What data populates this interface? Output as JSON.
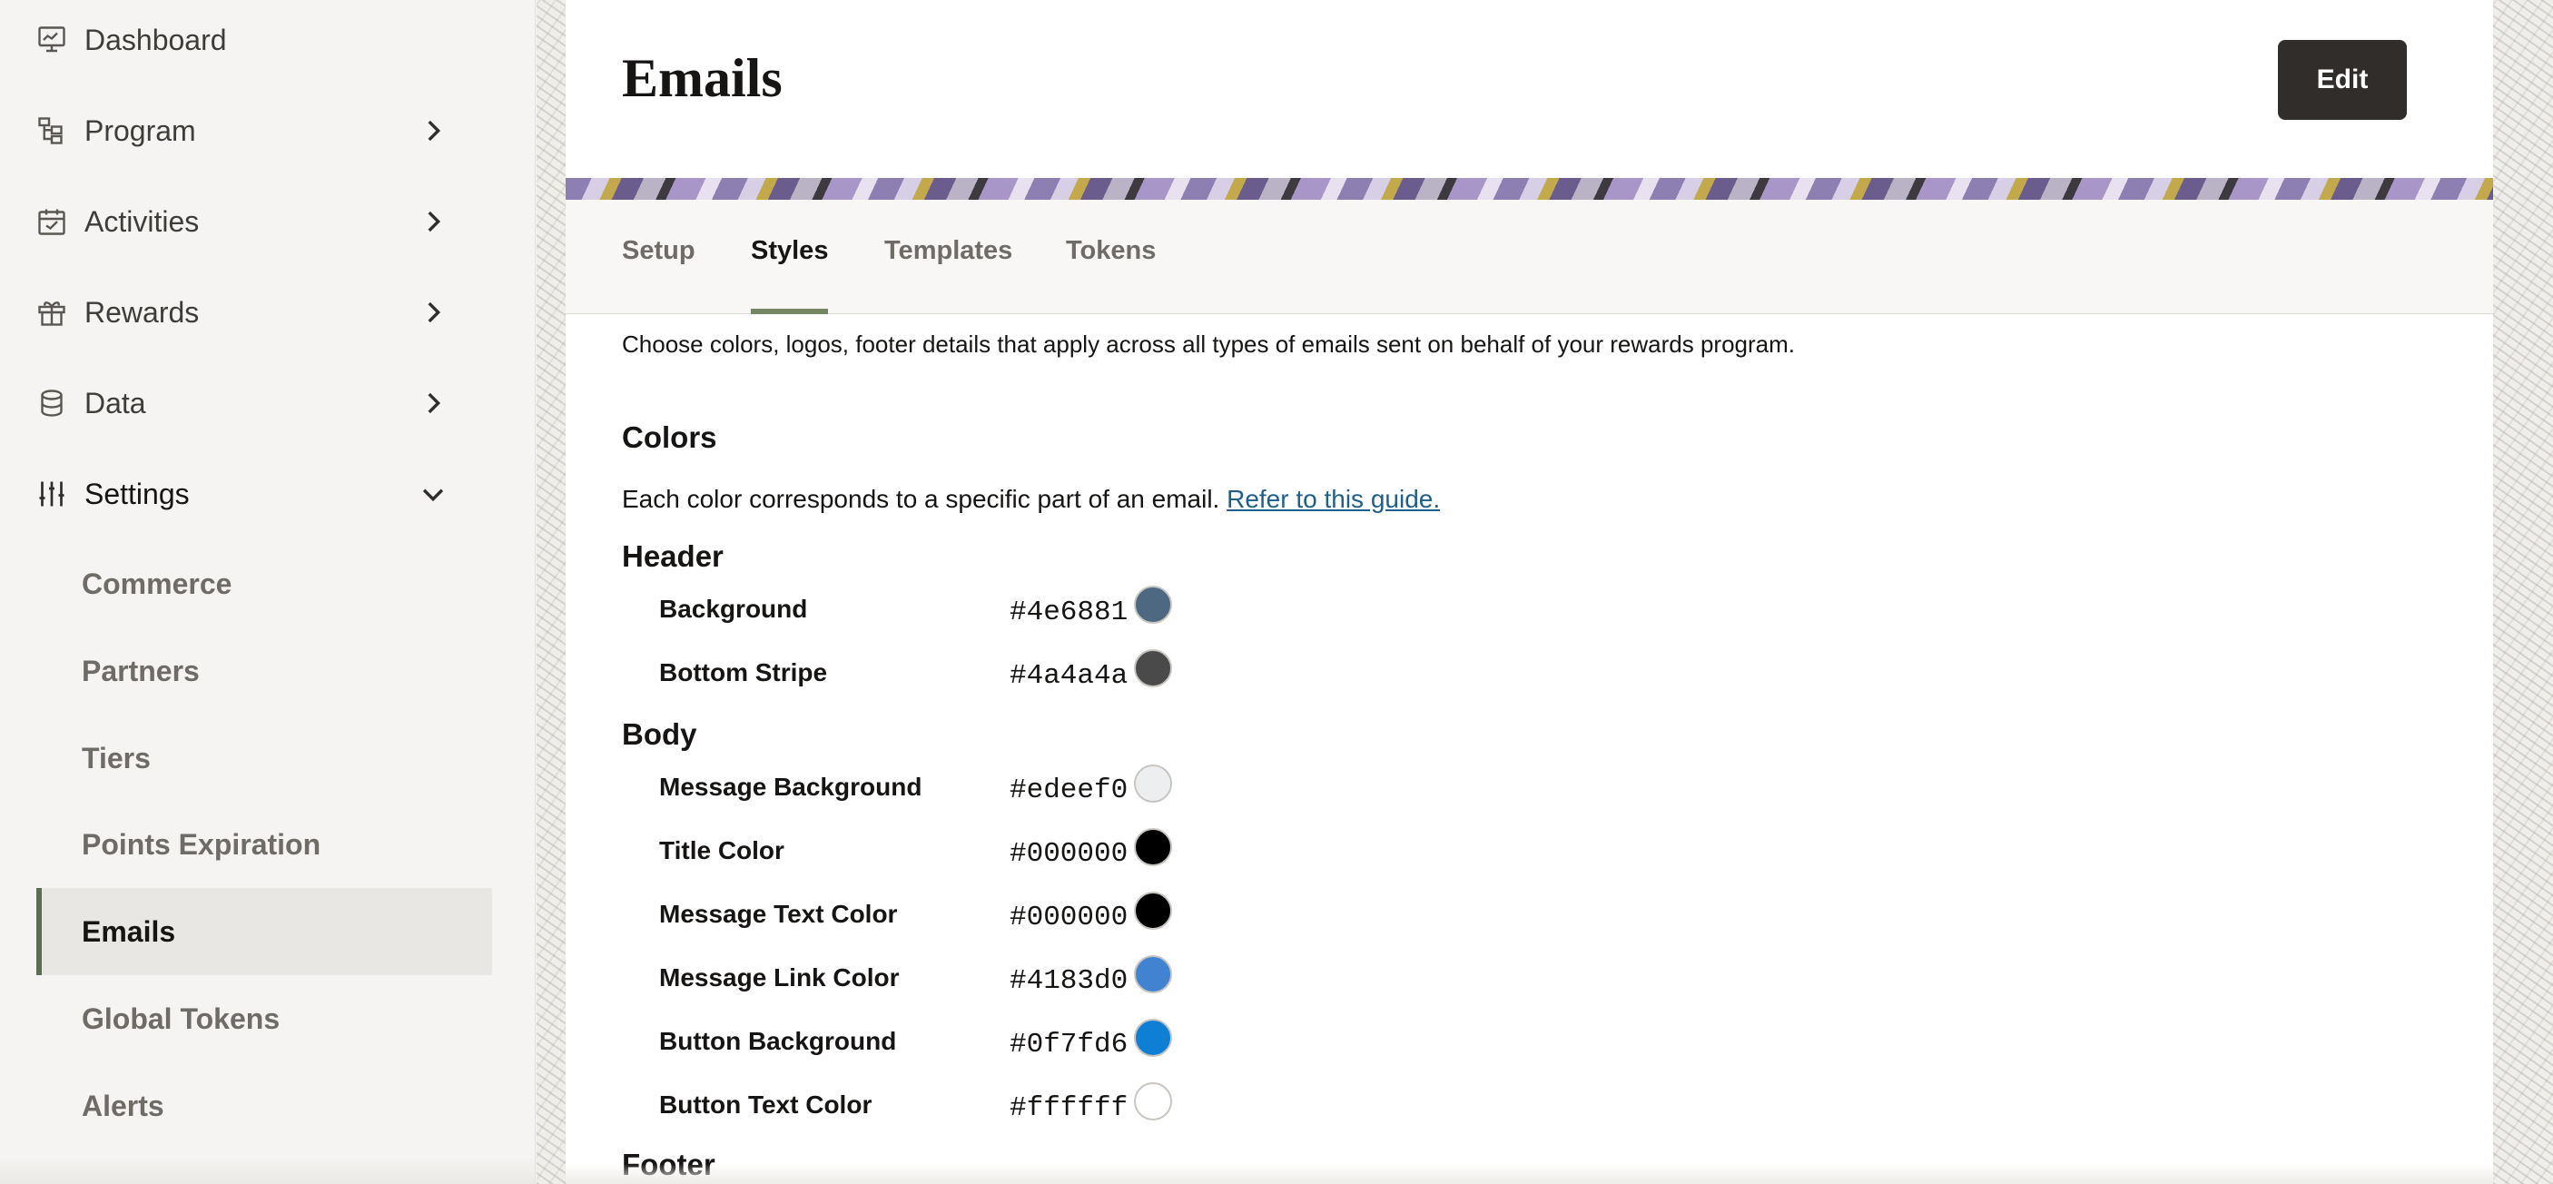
{
  "sidebar": {
    "items": [
      {
        "label": "Dashboard",
        "icon": "dashboard-icon"
      },
      {
        "label": "Program",
        "icon": "program-icon"
      },
      {
        "label": "Activities",
        "icon": "calendar-icon"
      },
      {
        "label": "Rewards",
        "icon": "gift-icon"
      },
      {
        "label": "Data",
        "icon": "database-icon"
      },
      {
        "label": "Settings",
        "icon": "sliders-icon"
      }
    ],
    "settings_sub": [
      {
        "label": "Commerce"
      },
      {
        "label": "Partners"
      },
      {
        "label": "Tiers"
      },
      {
        "label": "Points Expiration"
      },
      {
        "label": "Emails"
      },
      {
        "label": "Global Tokens"
      },
      {
        "label": "Alerts"
      }
    ]
  },
  "header": {
    "title": "Emails",
    "edit_label": "Edit"
  },
  "tabs": [
    {
      "label": "Setup"
    },
    {
      "label": "Styles"
    },
    {
      "label": "Templates"
    },
    {
      "label": "Tokens"
    }
  ],
  "content": {
    "intro": "Choose colors, logos, footer details that apply across all types of emails sent on behalf of your rewards program.",
    "colors_title": "Colors",
    "colors_desc": "Each color corresponds to a specific part of an email.",
    "guide_link": "Refer to this guide.",
    "header_group": {
      "title": "Header",
      "rows": [
        {
          "label": "Background",
          "hex": "#4e6881"
        },
        {
          "label": "Bottom Stripe",
          "hex": "#4a4a4a"
        }
      ]
    },
    "body_group": {
      "title": "Body",
      "rows": [
        {
          "label": "Message Background",
          "hex": "#edeef0"
        },
        {
          "label": "Title Color",
          "hex": "#000000"
        },
        {
          "label": "Message Text Color",
          "hex": "#000000"
        },
        {
          "label": "Message Link Color",
          "hex": "#4183d0"
        },
        {
          "label": "Button Background",
          "hex": "#0f7fd6"
        },
        {
          "label": "Button Text Color",
          "hex": "#ffffff"
        }
      ]
    },
    "footer_title": "Footer"
  }
}
